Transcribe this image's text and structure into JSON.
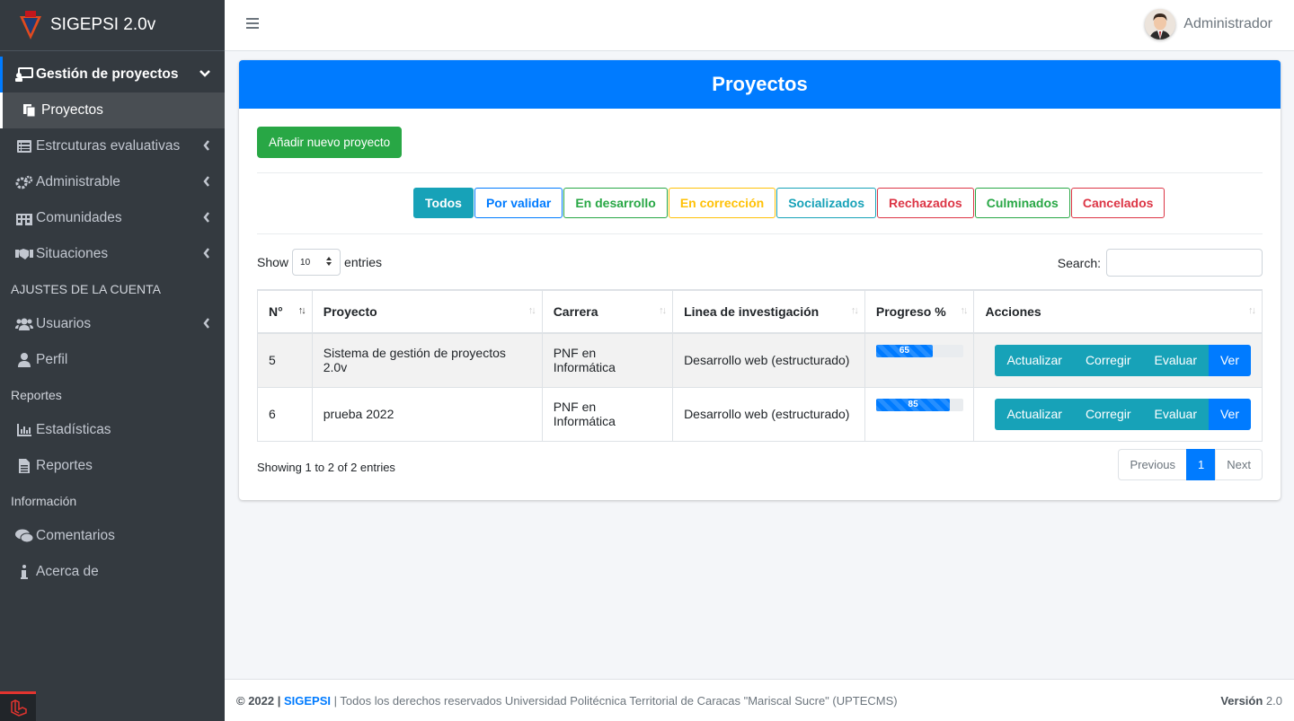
{
  "brand": {
    "name": "SIGEPSI 2.0v"
  },
  "topbar": {
    "user_name": "Administrador"
  },
  "sidebar": {
    "items": [
      {
        "label": "Gestión de proyectos",
        "icon": "projects-icon"
      },
      {
        "label": "Proyectos",
        "icon": "copy-icon"
      },
      {
        "label": "Estrcuturas evaluativas",
        "icon": "list-icon"
      },
      {
        "label": "Administrable",
        "icon": "cogs-icon"
      },
      {
        "label": "Comunidades",
        "icon": "building-icon"
      },
      {
        "label": "Situaciones",
        "icon": "handshake-icon"
      }
    ],
    "header_account": "AJUSTES DE LA CUENTA",
    "account_items": [
      {
        "label": "Usuarios",
        "icon": "users-icon"
      },
      {
        "label": "Perfil",
        "icon": "user-icon"
      }
    ],
    "header_reports": "Reportes",
    "report_items": [
      {
        "label": "Estadísticas",
        "icon": "chart-icon"
      },
      {
        "label": "Reportes",
        "icon": "file-icon"
      }
    ],
    "header_info": "Información",
    "info_items": [
      {
        "label": "Comentarios",
        "icon": "comments-icon"
      },
      {
        "label": "Acerca de",
        "icon": "info-icon"
      }
    ]
  },
  "card": {
    "title": "Proyectos",
    "add_button": "Añadir nuevo proyecto",
    "filters": [
      {
        "label": "Todos",
        "color": "#17a2b8"
      },
      {
        "label": "Por validar",
        "color": "#007bff"
      },
      {
        "label": "En desarrollo",
        "color": "#28a745"
      },
      {
        "label": "En corrección",
        "color": "#ffc107"
      },
      {
        "label": "Socializados",
        "color": "#17a2b8"
      },
      {
        "label": "Rechazados",
        "color": "#dc3545"
      },
      {
        "label": "Culminados",
        "color": "#28a745"
      },
      {
        "label": "Cancelados",
        "color": "#dc3545"
      }
    ],
    "show_label": "Show",
    "entries_value": "10",
    "entries_label": "entries",
    "search_label": "Search:",
    "columns": [
      "N°",
      "Proyecto",
      "Carrera",
      "Linea de investigación",
      "Progreso %",
      "Acciones"
    ],
    "rows": [
      {
        "n": "5",
        "proyecto": "Sistema de gestión de proyectos 2.0v",
        "carrera": "PNF en Informática",
        "linea": "Desarrollo web (estructurado)",
        "progreso": 65,
        "progreso_label": "65"
      },
      {
        "n": "6",
        "proyecto": "prueba 2022",
        "carrera": "PNF en Informática",
        "linea": "Desarrollo web (estructurado)",
        "progreso": 85,
        "progreso_label": "85"
      }
    ],
    "actions": {
      "actualizar": "Actualizar",
      "corregir": "Corregir",
      "evaluar": "Evaluar",
      "ver": "Ver"
    },
    "info": "Showing 1 to 2 of 2 entries",
    "pager": {
      "previous": "Previous",
      "page": "1",
      "next": "Next"
    }
  },
  "footer": {
    "copyright": "© 2022 |",
    "app": "SIGEPSI",
    "rights": "| Todos los derechos reservados Universidad Politécnica Territorial de Caracas \"Mariscal Sucre\" (UPTECMS)",
    "version_label": "Versión",
    "version": "2.0"
  }
}
